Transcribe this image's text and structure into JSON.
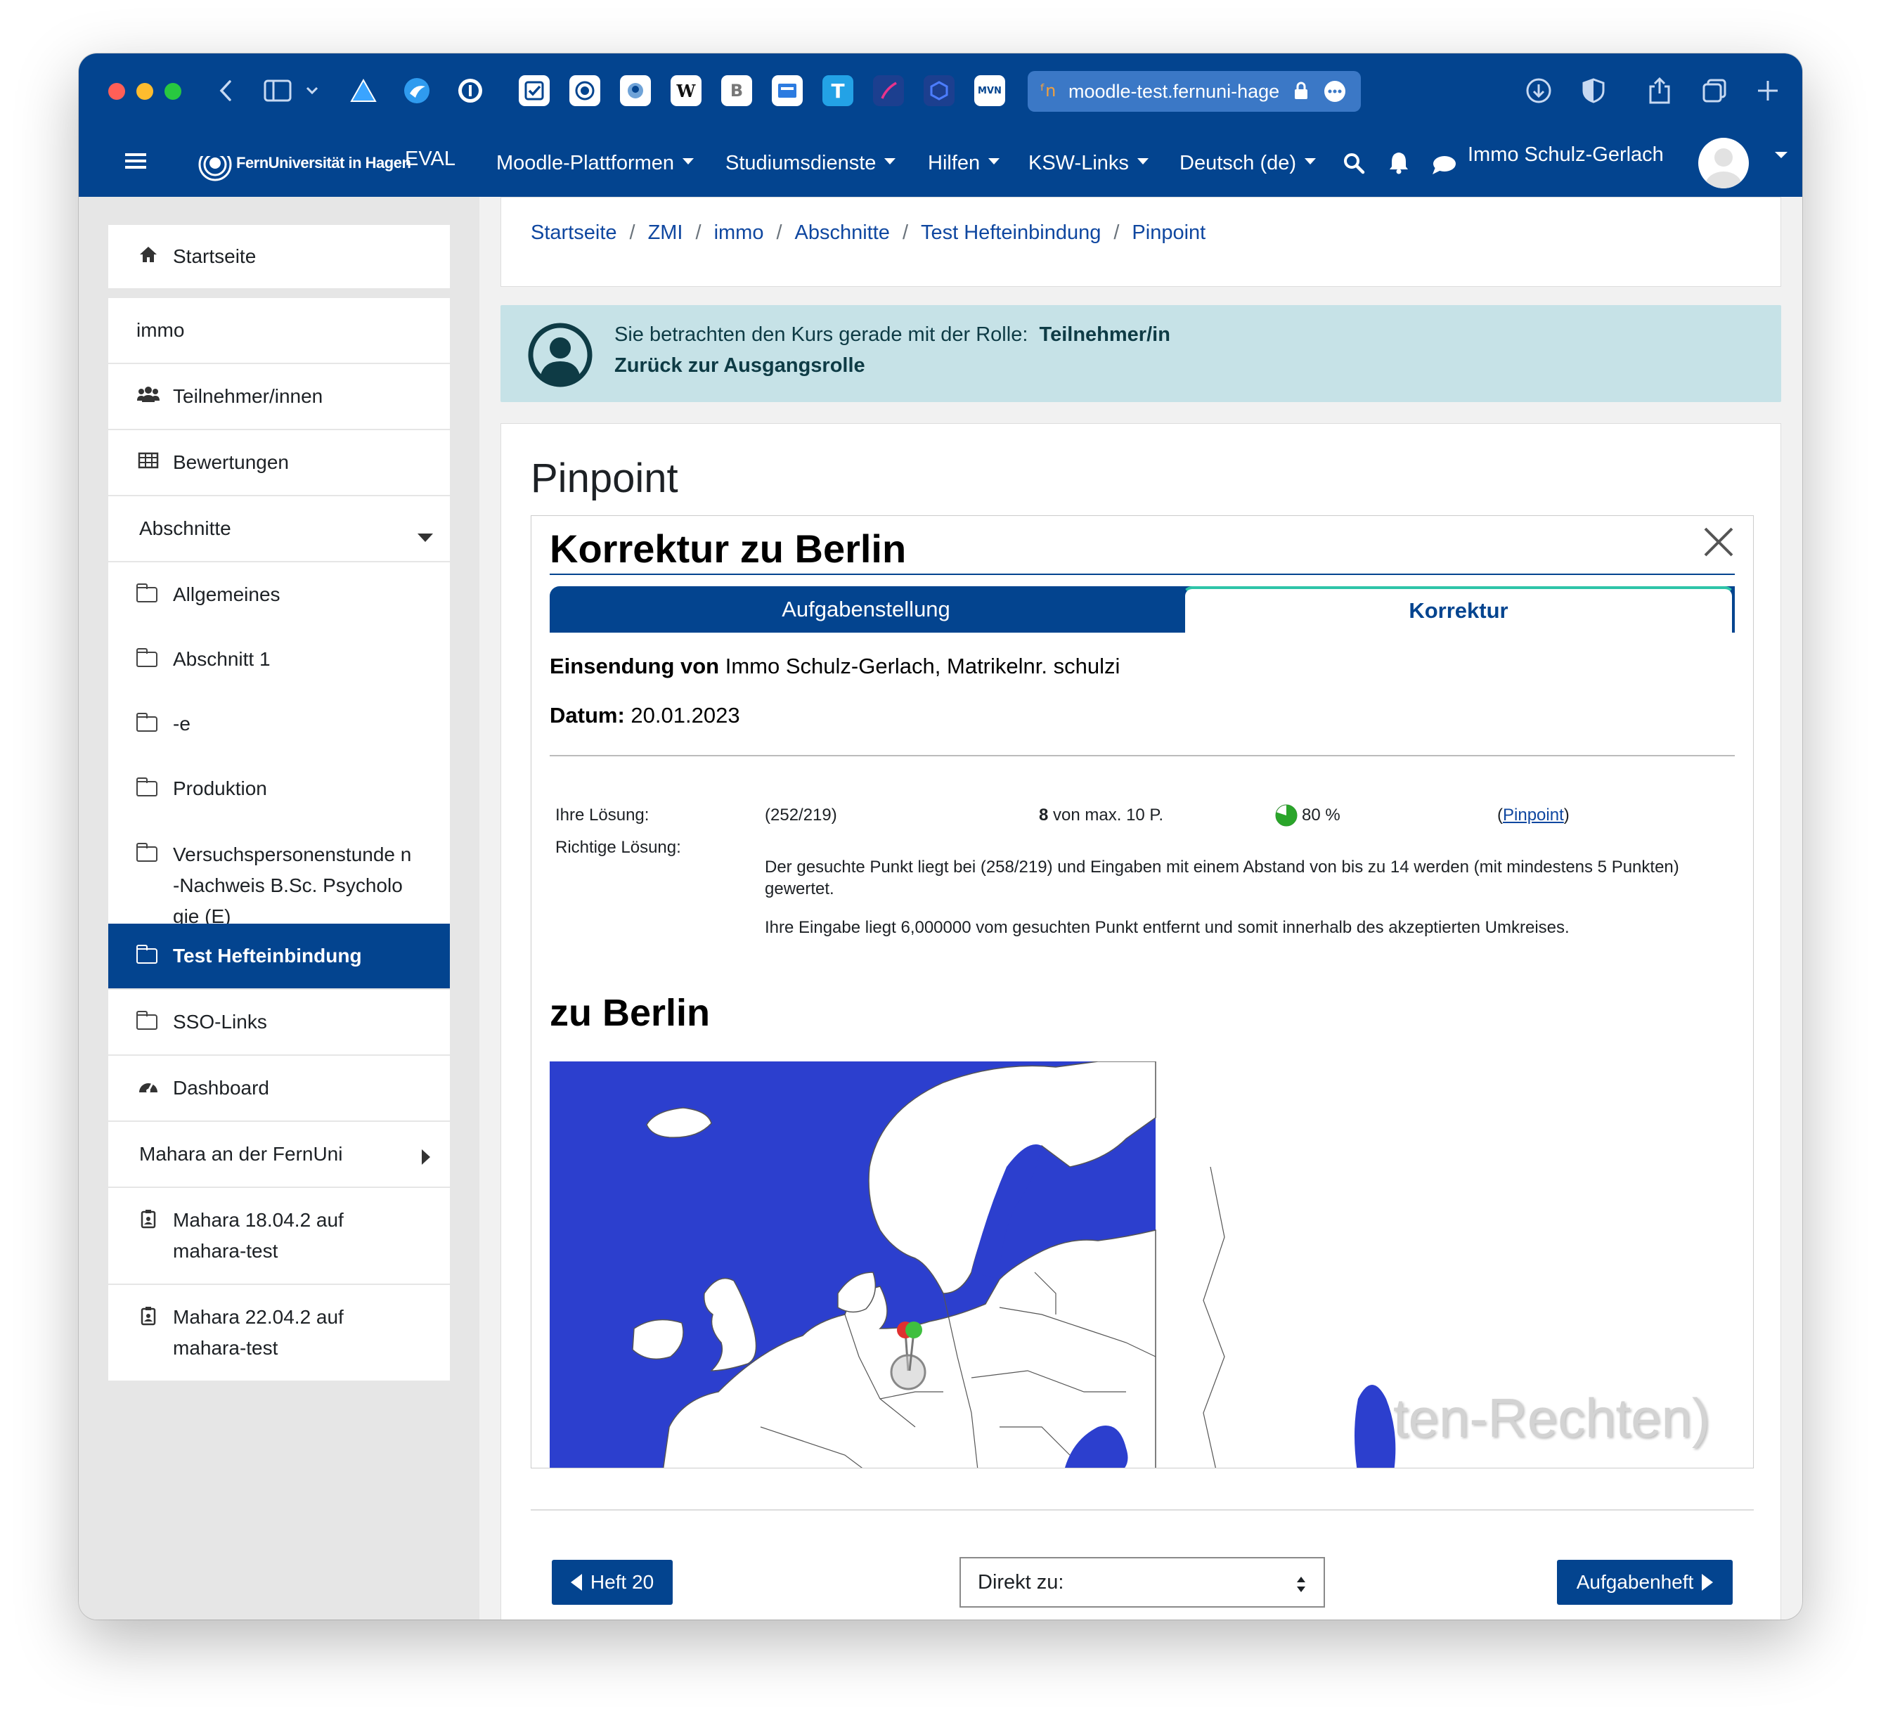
{
  "browser": {
    "url": "moodle-test.fernuni-hage",
    "tab_tiles": [
      "W",
      "B",
      "T",
      "MVN"
    ]
  },
  "navbar": {
    "brand": "FernUniversität in Hagen",
    "env_label": "EVAL",
    "menu": [
      "Moodle-Plattformen",
      "Studiumsdienste",
      "Hilfen",
      "KSW-Links",
      "Deutsch (de)"
    ],
    "user_name": "Immo Schulz-Gerlach"
  },
  "sidebar": {
    "items": [
      {
        "label": "Startseite",
        "icon": "home-icon"
      },
      {
        "label": "immo"
      },
      {
        "label": "Teilnehmer/innen",
        "icon": "users-icon"
      },
      {
        "label": "Bewertungen",
        "icon": "table-icon"
      },
      {
        "label": "Abschnitte",
        "icon": "caret-down-icon"
      },
      {
        "label": "Allgemeines",
        "icon": "folder-icon"
      },
      {
        "label": "Abschnitt 1",
        "icon": "folder-icon"
      },
      {
        "label": "-e",
        "icon": "folder-icon"
      },
      {
        "label": "Produktion",
        "icon": "folder-icon"
      },
      {
        "label": "Versuchspersonenstunde n-Nachweis B.Sc. Psychologie (E)",
        "icon": "folder-icon"
      },
      {
        "label": "Test Hefteinbindung",
        "icon": "folder-icon",
        "active": true
      },
      {
        "label": "SSO-Links",
        "icon": "folder-icon"
      },
      {
        "label": "Dashboard",
        "icon": "dashboard-icon"
      },
      {
        "label": "Mahara an der FernUni",
        "icon": "caret-right-icon"
      },
      {
        "label": "Mahara 18.04.2 auf mahara-test",
        "icon": "portfolio-icon"
      },
      {
        "label": "Mahara 22.04.2 auf mahara-test",
        "icon": "portfolio-icon"
      }
    ]
  },
  "breadcrumb": [
    "Startseite",
    "ZMI",
    "immo",
    "Abschnitte",
    "Test Hefteinbindung",
    "Pinpoint"
  ],
  "role_notice": {
    "text": "Sie betrachten den Kurs gerade mit der Rolle:",
    "role": "Teilnehmer/in",
    "return_link": "Zurück zur Ausgangsrolle"
  },
  "page": {
    "title": "Pinpoint",
    "panel_title": "Korrektur zu Berlin",
    "tabs": [
      "Aufgabenstellung",
      "Korrektur"
    ],
    "submission_label": "Einsendung von",
    "submission_value": "Immo Schulz-Gerlach, Matrikelnr. schulzi",
    "date_label": "Datum:",
    "date_value": "20.01.2023",
    "result": {
      "your_solution_label": "Ihre Lösung:",
      "your_solution_value": "(252/219)",
      "points_value": "8",
      "points_suffix": "von max. 10 P.",
      "percent": "80 %",
      "percent_value": 0.8,
      "link_prefix": "(",
      "link_text": "Pinpoint",
      "link_suffix": ")",
      "correct_label": "Richtige Lösung:",
      "correct_text_1": "Der gesuchte Punkt liegt bei (258/219) und Eingaben mit einem Abstand von bis zu 14 werden (mit mindestens 5 Punkten) gewertet.",
      "correct_text_2": "Ihre Eingabe liegt 6,000000 vom gesuchten Punkt entfernt und somit innerhalb des akzeptierten Umkreises."
    },
    "map_heading": "zu Berlin",
    "watermark": "ten-Rechten)"
  },
  "footer_nav": {
    "prev_label": "Heft 20",
    "select_label": "Direkt zu:",
    "next_label": "Aufgabenheft"
  },
  "colors": {
    "primary": "#03448f",
    "sea": "#2c3fce",
    "notice_bg": "#c6e2e7",
    "tab_active_border": "#2ec4a8"
  }
}
